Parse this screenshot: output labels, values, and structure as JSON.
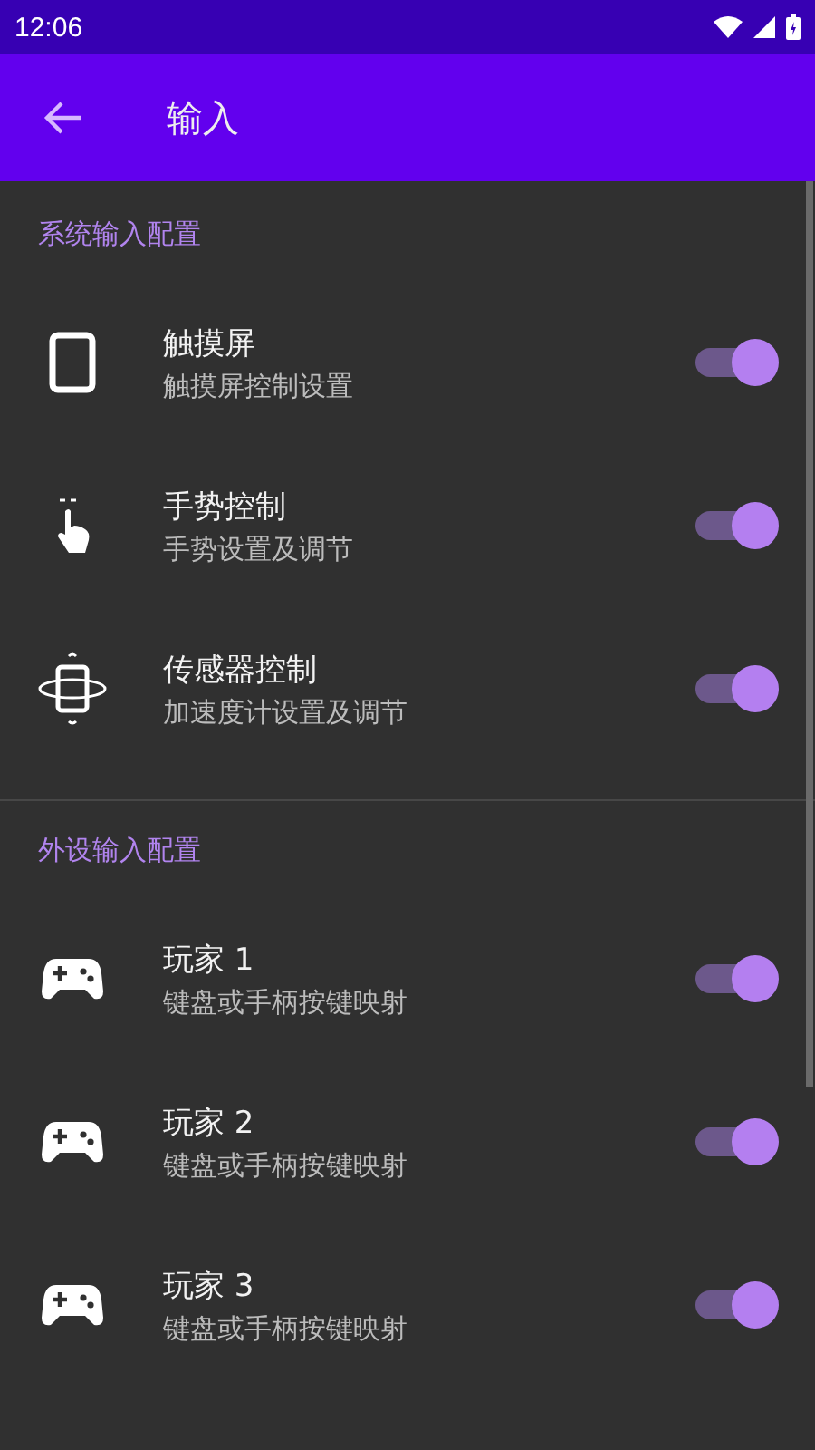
{
  "status_bar": {
    "time": "12:06"
  },
  "app_bar": {
    "title": "输入"
  },
  "sections": [
    {
      "title": "系统输入配置",
      "items": [
        {
          "kind": "phone",
          "title": "触摸屏",
          "subtitle": "触摸屏控制设置",
          "on": true
        },
        {
          "kind": "gesture",
          "title": "手势控制",
          "subtitle": "手势设置及调节",
          "on": true
        },
        {
          "kind": "sensor",
          "title": "传感器控制",
          "subtitle": "加速度计设置及调节",
          "on": true
        }
      ]
    },
    {
      "title": "外设输入配置",
      "items": [
        {
          "kind": "gamepad",
          "title": "玩家 1",
          "subtitle": "键盘或手柄按键映射",
          "on": true
        },
        {
          "kind": "gamepad",
          "title": "玩家 2",
          "subtitle": "键盘或手柄按键映射",
          "on": true
        },
        {
          "kind": "gamepad",
          "title": "玩家 3",
          "subtitle": "键盘或手柄按键映射",
          "on": true
        }
      ]
    }
  ]
}
